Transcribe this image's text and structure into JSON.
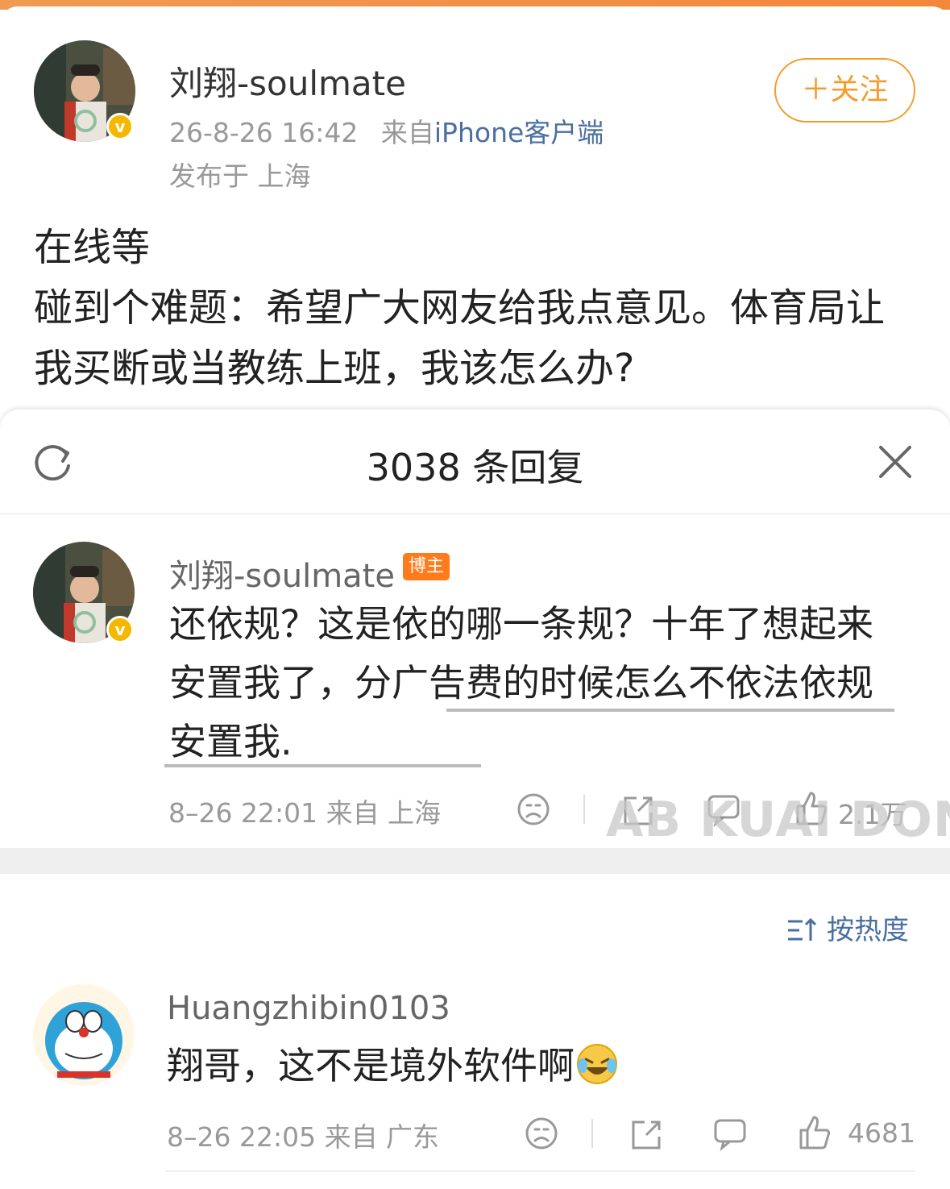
{
  "post": {
    "author": "刘翔-soulmate",
    "time": "26-8-26 16:42",
    "from_prefix": "来自",
    "source": "iPhone客户端",
    "location": "发布于 上海",
    "follow_label": "＋关注",
    "text_line1": "在线等",
    "text_line2": "碰到个难题：希望广大网友给我点意见。体育局让我买断或当教练上班，我该怎么办?"
  },
  "sheet": {
    "title": "3038 条回复"
  },
  "reply_main": {
    "author": "刘翔-soulmate",
    "tag": "博主",
    "text": "还依规？这是依的哪一条规？十年了想起来安置我了，分广告费的时候怎么不依法依规安置我.",
    "meta": "8–26 22:01 来自 上海",
    "like_count": "2.1万"
  },
  "watermark": "AB KUAI DONG",
  "sort": {
    "label": "按热度"
  },
  "reply_two": {
    "author": "Huangzhibin0103",
    "text": "翔哥，这不是境外软件啊",
    "emoji": "laughing-crying-emoji",
    "meta": "8–26 22:05 来自 广东",
    "like_count": "4681"
  },
  "colors": {
    "accent_orange": "#f39c2b",
    "link_blue": "#4a6fa0",
    "tag_orange": "#ff7a1a",
    "verified_yellow": "#f5b800"
  }
}
